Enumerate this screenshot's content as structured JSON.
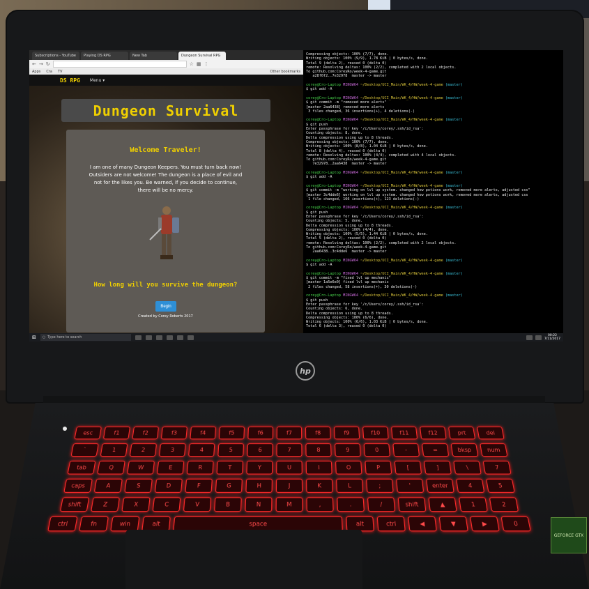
{
  "browser": {
    "tabs": [
      "Subscriptions - YouTube",
      "Playing DS RPG",
      "New Tab",
      "Dungeon Survival RPG"
    ],
    "active_tab": 3,
    "bookmarks": [
      "Apps",
      "Cra",
      "TV"
    ],
    "other_bookmarks": "Other bookmarks"
  },
  "site": {
    "brand": "DS RPG",
    "menu": "Menu ▾",
    "title": "Dungeon Survival",
    "welcome": "Welcome Traveler!",
    "intro": "I am one of many Dungeon Keepers. You must turn back now! Outsiders are not welcome! The dungeon is a place of evil and not for the likes you. Be warned, if you decide to continue, there will be no mercy.",
    "question": "How long will you survive the dungeon?",
    "begin": "Begin",
    "credit": "Created by Corey Roberts 2017"
  },
  "taskbar": {
    "search_placeholder": "Type here to search",
    "time": "00:22",
    "date": "7/11/2017"
  },
  "terminal": {
    "lines": [
      {
        "t": "out",
        "text": "Compressing objects: 100% (7/7), done."
      },
      {
        "t": "out",
        "text": "Writing objects: 100% (9/9), 1.78 KiB | 0 bytes/s, done."
      },
      {
        "t": "out",
        "text": "Total 9 (delta 2), reused 0 (delta 0)"
      },
      {
        "t": "out",
        "text": "remote: Resolving deltas: 100% (2/2), completed with 2 local objects."
      },
      {
        "t": "out",
        "text": "To github.com:CoreyRo/week-4-game.git"
      },
      {
        "t": "out",
        "text": "   a28f0f2..7e32978  master -> master"
      },
      {
        "t": "blank",
        "text": ""
      },
      {
        "t": "prompt",
        "user": "corey@Cro-Laptop",
        "host": "MINGW64",
        "path": "~/Desktop/UCI_Main/WK_4/HW/week-4-game",
        "branch": "(master)"
      },
      {
        "t": "out",
        "text": "$ git add -A"
      },
      {
        "t": "blank",
        "text": ""
      },
      {
        "t": "prompt",
        "user": "corey@Cro-Laptop",
        "host": "MINGW64",
        "path": "~/Desktop/UCI_Main/WK_4/HW/week-4-game",
        "branch": "(master)"
      },
      {
        "t": "out",
        "text": "$ git commit -m \"removed more alerts\""
      },
      {
        "t": "out",
        "text": "[master 2aa6438] removed more alerts"
      },
      {
        "t": "out",
        "text": " 3 files changed, 36 insertions(+), 4 deletions(-)"
      },
      {
        "t": "blank",
        "text": ""
      },
      {
        "t": "prompt",
        "user": "corey@Cro-Laptop",
        "host": "MINGW64",
        "path": "~/Desktop/UCI_Main/WK_4/HW/week-4-game",
        "branch": "(master)"
      },
      {
        "t": "out",
        "text": "$ git push"
      },
      {
        "t": "out",
        "text": "Enter passphrase for key '/c/Users/corey/.ssh/id_rsa':"
      },
      {
        "t": "out",
        "text": "Counting objects: 8, done."
      },
      {
        "t": "out",
        "text": "Delta compression using up to 8 threads."
      },
      {
        "t": "out",
        "text": "Compressing objects: 100% (7/7), done."
      },
      {
        "t": "out",
        "text": "Writing objects: 100% (8/8), 1.04 KiB | 0 bytes/s, done."
      },
      {
        "t": "out",
        "text": "Total 8 (delta 4), reused 0 (delta 0)"
      },
      {
        "t": "out",
        "text": "remote: Resolving deltas: 100% (4/4), completed with 4 local objects."
      },
      {
        "t": "out",
        "text": "To github.com:CoreyRo/week-4-game.git"
      },
      {
        "t": "out",
        "text": "   7e32978..2aa6438  master -> master"
      },
      {
        "t": "blank",
        "text": ""
      },
      {
        "t": "prompt",
        "user": "corey@Cro-Laptop",
        "host": "MINGW64",
        "path": "~/Desktop/UCI_Main/WK_4/HW/week-4-game",
        "branch": "(master)"
      },
      {
        "t": "out",
        "text": "$ git add -A"
      },
      {
        "t": "blank",
        "text": ""
      },
      {
        "t": "prompt",
        "user": "corey@Cro-Laptop",
        "host": "MINGW64",
        "path": "~/Desktop/UCI_Main/WK_4/HW/week-4-game",
        "branch": "(master)"
      },
      {
        "t": "out",
        "text": "$ git commit -m \"working on lvl up system. changed how potions work, removed more alerts, adjusted css\""
      },
      {
        "t": "out",
        "text": "[master 3c4dde6] working on lvl up system. changed how potions work, removed more alerts, adjusted css"
      },
      {
        "t": "out",
        "text": " 1 file changed, 166 insertions(+), 123 deletions(-)"
      },
      {
        "t": "blank",
        "text": ""
      },
      {
        "t": "prompt",
        "user": "corey@Cro-Laptop",
        "host": "MINGW64",
        "path": "~/Desktop/UCI_Main/WK_4/HW/week-4-game",
        "branch": "(master)"
      },
      {
        "t": "out",
        "text": "$ git push"
      },
      {
        "t": "out",
        "text": "Enter passphrase for key '/c/Users/corey/.ssh/id_rsa':"
      },
      {
        "t": "out",
        "text": "Counting objects: 5, done."
      },
      {
        "t": "out",
        "text": "Delta compression using up to 8 threads."
      },
      {
        "t": "out",
        "text": "Compressing objects: 100% (4/4), done."
      },
      {
        "t": "out",
        "text": "Writing objects: 100% (5/5), 1.44 KiB | 0 bytes/s, done."
      },
      {
        "t": "out",
        "text": "Total 5 (delta 2), reused 0 (delta 0)"
      },
      {
        "t": "out",
        "text": "remote: Resolving deltas: 100% (2/2), completed with 2 local objects."
      },
      {
        "t": "out",
        "text": "To github.com:CoreyRo/week-4-game.git"
      },
      {
        "t": "out",
        "text": "   2aa6438..3c4dde6  master -> master"
      },
      {
        "t": "blank",
        "text": ""
      },
      {
        "t": "prompt",
        "user": "corey@Cro-Laptop",
        "host": "MINGW64",
        "path": "~/Desktop/UCI_Main/WK_4/HW/week-4-game",
        "branch": "(master)"
      },
      {
        "t": "out",
        "text": "$ git add -A"
      },
      {
        "t": "blank",
        "text": ""
      },
      {
        "t": "prompt",
        "user": "corey@Cro-Laptop",
        "host": "MINGW64",
        "path": "~/Desktop/UCI_Main/WK_4/HW/week-4-game",
        "branch": "(master)"
      },
      {
        "t": "out",
        "text": "$ git commit -m \"fixed lvl up mechanic\""
      },
      {
        "t": "out",
        "text": "[master 1a5e6e0] fixed lvl up mechanic"
      },
      {
        "t": "out",
        "text": " 2 files changed, 58 insertions(+), 30 deletions(-)"
      },
      {
        "t": "blank",
        "text": ""
      },
      {
        "t": "prompt",
        "user": "corey@Cro-Laptop",
        "host": "MINGW64",
        "path": "~/Desktop/UCI_Main/WK_4/HW/week-4-game",
        "branch": "(master)"
      },
      {
        "t": "out",
        "text": "$ git push"
      },
      {
        "t": "out",
        "text": "Enter passphrase for key '/c/Users/corey/.ssh/id_rsa':"
      },
      {
        "t": "out",
        "text": "Counting objects: 6, done."
      },
      {
        "t": "out",
        "text": "Delta compression using up to 8 threads."
      },
      {
        "t": "out",
        "text": "Compressing objects: 100% (6/6), done."
      },
      {
        "t": "out",
        "text": "Writing objects: 100% (6/6), 1.03 KiB | 0 bytes/s, done."
      },
      {
        "t": "out",
        "text": "Total 6 (delta 3), reused 0 (delta 0)"
      }
    ]
  },
  "laptop": {
    "logo": "hp",
    "sticker": "GEFORCE GTX"
  },
  "keyboard": {
    "rows": [
      [
        "esc",
        "f1",
        "f2",
        "f3",
        "f4",
        "f5",
        "f6",
        "f7",
        "f8",
        "f9",
        "f10",
        "f11",
        "f12",
        "prt",
        "del"
      ],
      [
        "`",
        "1",
        "2",
        "3",
        "4",
        "5",
        "6",
        "7",
        "8",
        "9",
        "0",
        "-",
        "=",
        "bksp",
        "num"
      ],
      [
        "tab",
        "Q",
        "W",
        "E",
        "R",
        "T",
        "Y",
        "U",
        "I",
        "O",
        "P",
        "[",
        "]",
        "\\",
        "7"
      ],
      [
        "caps",
        "A",
        "S",
        "D",
        "F",
        "G",
        "H",
        "J",
        "K",
        "L",
        ";",
        "'",
        "enter",
        "4",
        "5"
      ],
      [
        "shift",
        "Z",
        "X",
        "C",
        "V",
        "B",
        "N",
        "M",
        ",",
        ".",
        "/",
        "shift",
        "▲",
        "1",
        "2"
      ],
      [
        "ctrl",
        "fn",
        "win",
        "alt",
        "space",
        "alt",
        "ctrl",
        "◀",
        "▼",
        "▶",
        "0"
      ]
    ]
  },
  "colors": {
    "title_yellow": "#f0d000",
    "key_red": "#ff2a2a",
    "prompt_green": "#46d04a",
    "prompt_purple": "#c86ad8",
    "prompt_yellow": "#d8c33a",
    "begin_blue": "#2e8fd6"
  }
}
